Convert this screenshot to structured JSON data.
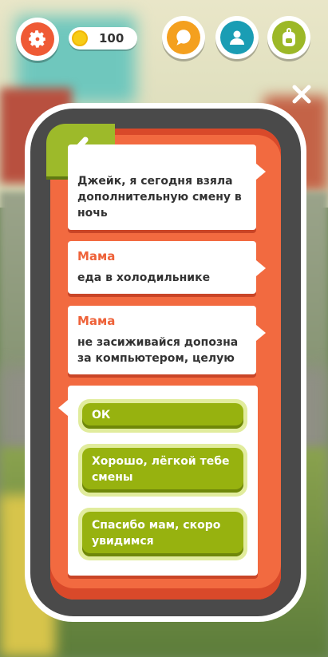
{
  "hud": {
    "coins": "100",
    "icons": {
      "settings": "gear-icon",
      "chat": "chat-bubble-icon",
      "profile": "person-icon",
      "backpack": "backpack-icon",
      "coin": "coin-icon",
      "close": "close-icon"
    }
  },
  "chat": {
    "back_icon": "chevron-left-icon",
    "messages": [
      {
        "sender": "",
        "text": "Джейк, я сегодня взяла дополнительную смену в ночь"
      },
      {
        "sender": "Мама",
        "text": "еда в холодильнике"
      },
      {
        "sender": "Мама",
        "text": "не засиживайся допозна за компьютером, целую"
      }
    ],
    "replies": [
      {
        "label": "ОК"
      },
      {
        "label": "Хорошо, лёгкой тебе смены"
      },
      {
        "label": "Спасибо мам, скоро увидимся"
      }
    ]
  },
  "colors": {
    "accent_orange": "#ef5a35",
    "screen": "#f26a40",
    "reply_green": "#97b20f",
    "sender": "#ee6239"
  }
}
